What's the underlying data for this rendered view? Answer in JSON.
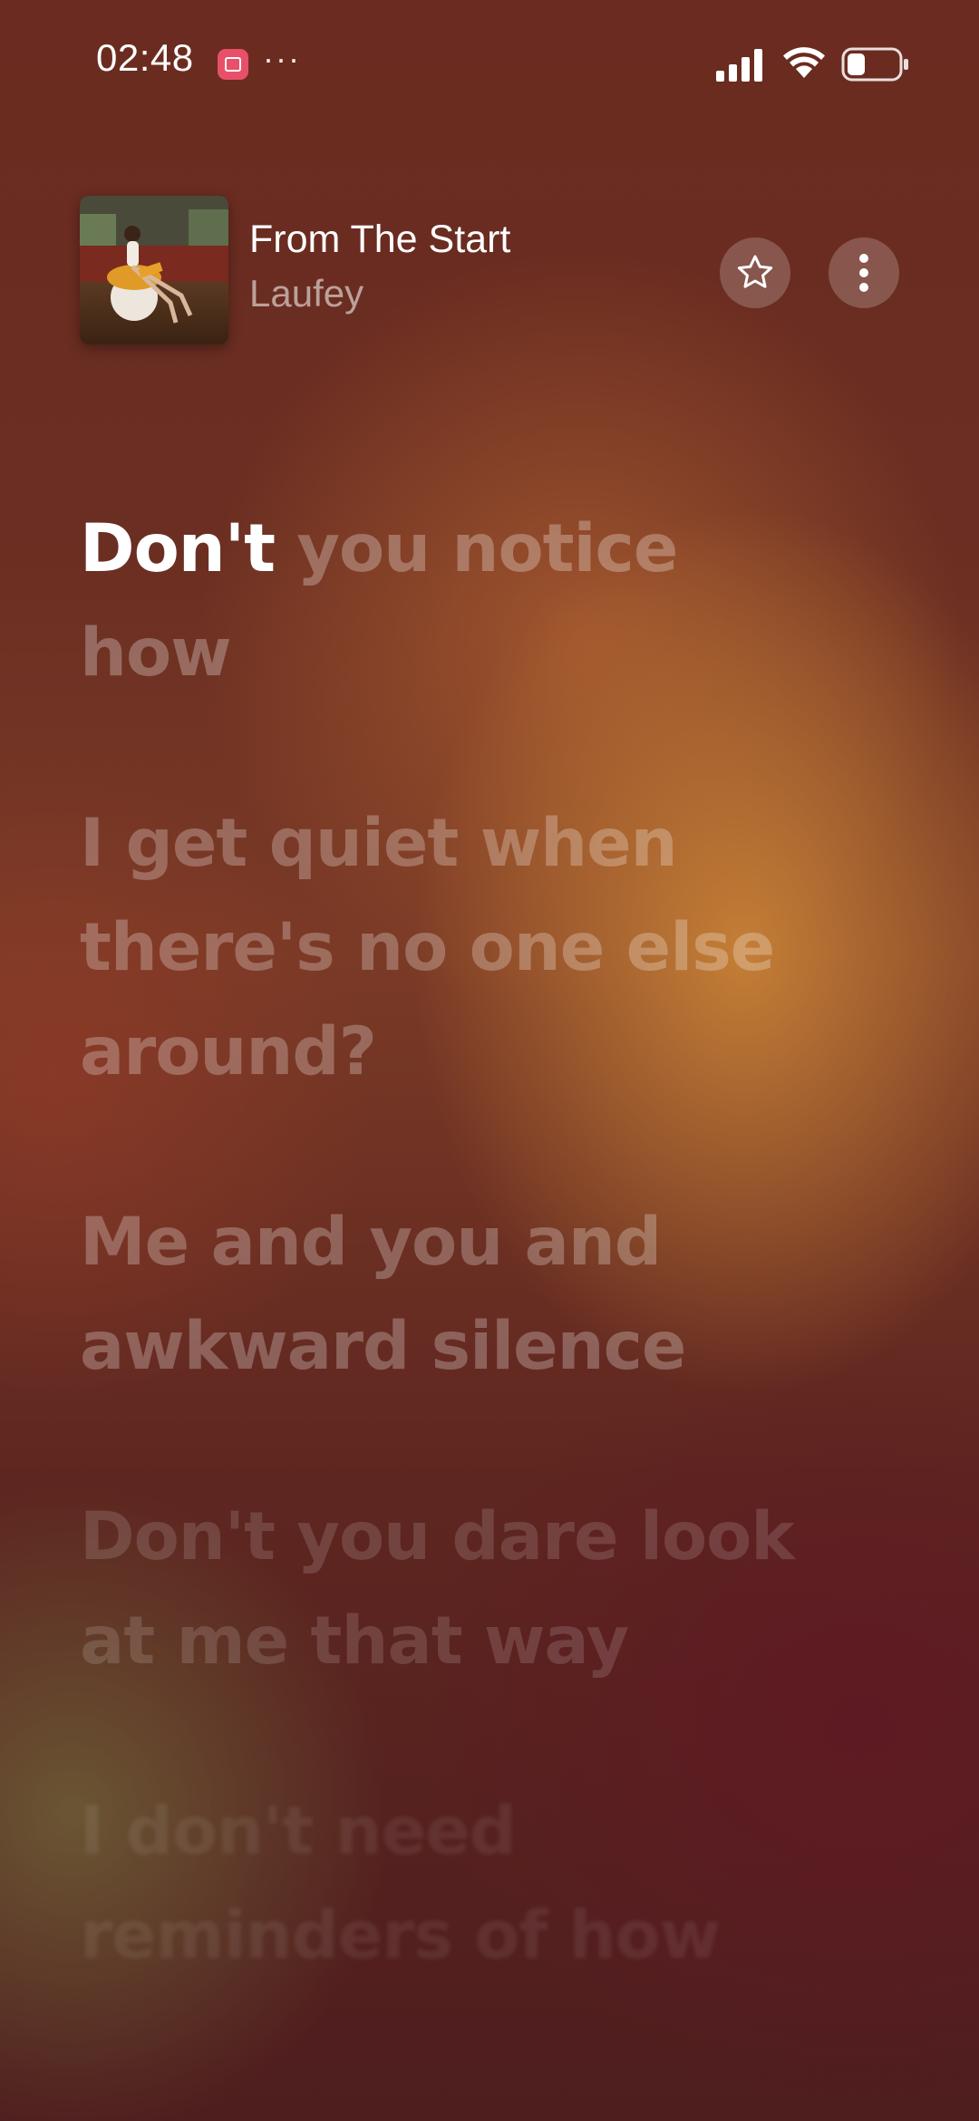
{
  "status_bar": {
    "time": "02:48",
    "notification_icon": "app-notification-icon",
    "more_indicator": "···",
    "signal_icon": "cellular-signal-icon",
    "wifi_icon": "wifi-icon",
    "battery_icon": "battery-icon",
    "battery_level": 0.35
  },
  "now_playing": {
    "title": "From The Start",
    "artist": "Laufey",
    "favorite_icon": "star-outline-icon",
    "menu_icon": "vertical-ellipsis-icon"
  },
  "lyrics": {
    "current_line": {
      "sung": "Don't",
      "unsung_line1": "you notice",
      "unsung_line2": "how"
    },
    "upcoming": [
      {
        "lines": [
          "I get quiet when",
          "there's no one else",
          "around?"
        ]
      },
      {
        "lines": [
          "Me and you and",
          "awkward silence"
        ]
      },
      {
        "lines": [
          "Don't you dare look",
          "at me that way"
        ]
      },
      {
        "lines": [
          "I don't need",
          "reminders of how"
        ]
      }
    ]
  },
  "colors": {
    "background_top": "#6b2b20",
    "glow": "#c88237",
    "background_bottom": "#4e1d1e"
  }
}
